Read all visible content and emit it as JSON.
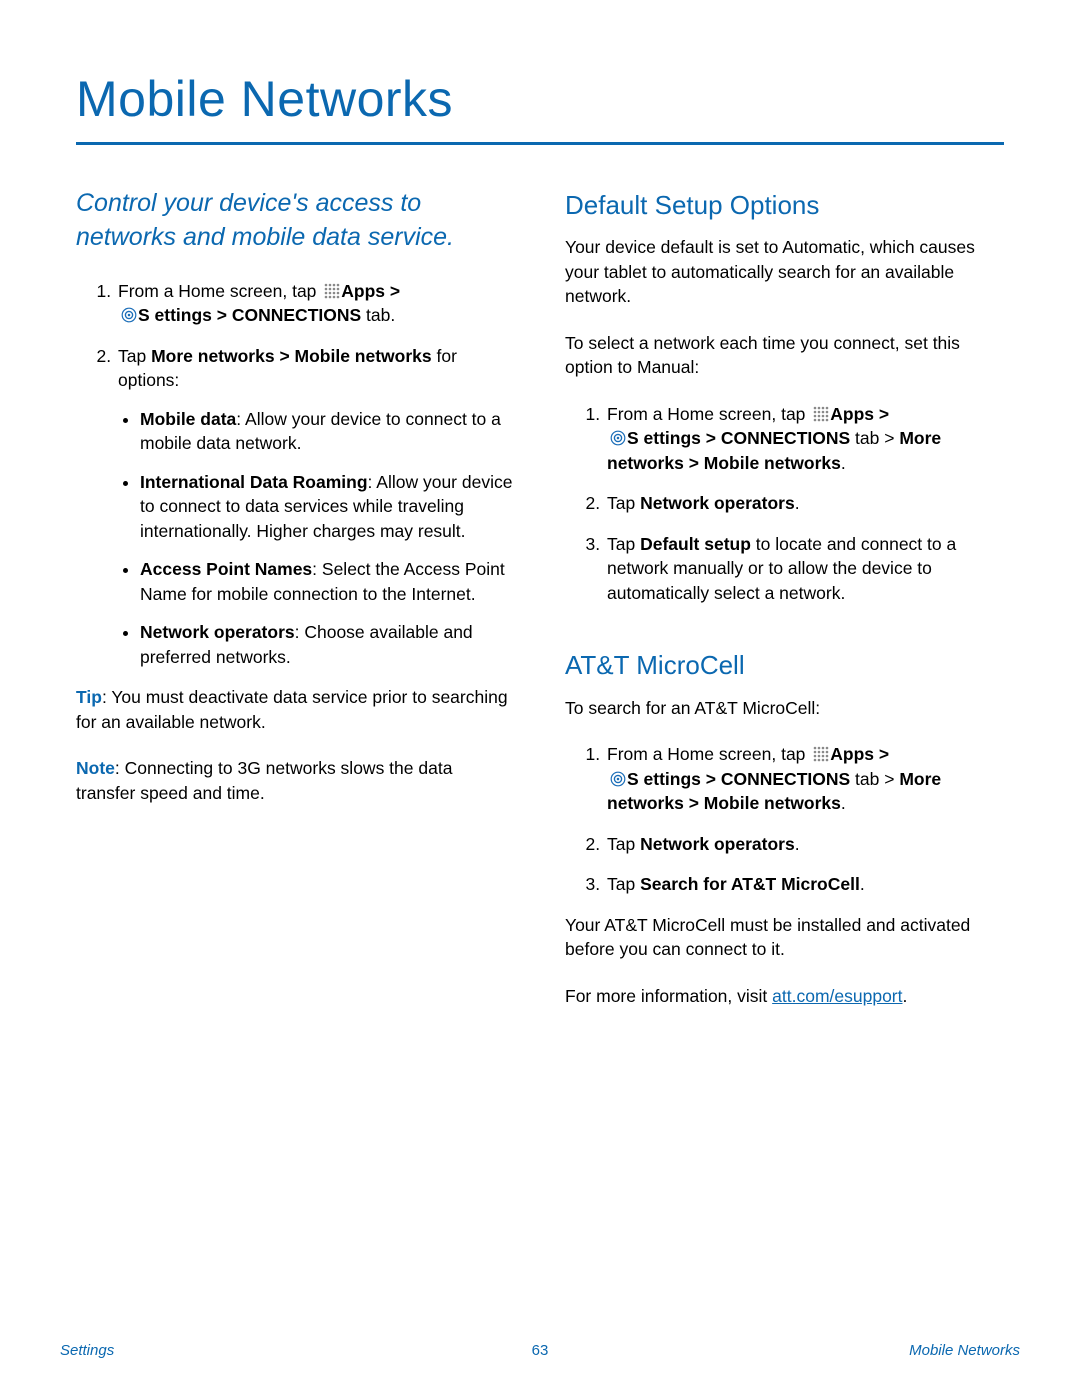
{
  "title": "Mobile Networks",
  "intro": "Control your device's access to networks and mobile data service.",
  "left": {
    "step1": {
      "pre": "From a Home screen, tap ",
      "apps": "Apps",
      "gt1": " > ",
      "settings": "S ettings",
      "gt2": " > ",
      "connections": "CONNECTIONS",
      "tail": " tab."
    },
    "step2": {
      "pre": "Tap ",
      "bold": "More networks > Mobile networks",
      "tail": " for options:"
    },
    "bullets": {
      "b1": {
        "label": "Mobile data",
        "text": ": Allow your device to connect to a mobile data network."
      },
      "b2": {
        "label": "International Data Roaming",
        "text": ": Allow your device to connect to data services while traveling internationally. Higher charges may result."
      },
      "b3": {
        "label": "Access Point Names",
        "text": ": Select the Access Point Name for mobile connection to the Internet."
      },
      "b4": {
        "label": "Network operators",
        "text": ": Choose available and preferred networks."
      }
    },
    "tip": {
      "label": "Tip",
      "text": ": You must deactivate data service prior to searching for an available network."
    },
    "note": {
      "label": "Note",
      "text": ": Connecting to 3G networks slows the data transfer speed and time."
    }
  },
  "right": {
    "sec1": {
      "heading": "Default Setup Options",
      "p1": "Your device default is set to Automatic, which causes your tablet to automatically search for an available network.",
      "p2": "To select a network each time you connect, set this option to Manual:",
      "step1": {
        "pre": "From a Home screen, tap ",
        "apps": "Apps",
        "gt1": " > ",
        "settings": "S ettings",
        "gt2": " > ",
        "connections": "CONNECTIONS",
        "mid": " tab > ",
        "more": "More networks > Mobile networks",
        "tail": "."
      },
      "step2": {
        "pre": "Tap ",
        "bold": "Network operators",
        "tail": "."
      },
      "step3": {
        "pre": "Tap ",
        "bold": "Default setup",
        "tail": " to locate and connect to a network manually or to allow the device to automatically select a network."
      }
    },
    "sec2": {
      "heading": "AT&T MicroCell",
      "p1": "To search for an AT&T MicroCell:",
      "step1": {
        "pre": "From a Home screen, tap ",
        "apps": "Apps",
        "gt1": " > ",
        "settings": "S ettings",
        "gt2": " > ",
        "connections": "CONNECTIONS",
        "mid": " tab > ",
        "more": "More networks > Mobile networks",
        "tail": "."
      },
      "step2": {
        "pre": "Tap ",
        "bold": "Network operators",
        "tail": "."
      },
      "step3": {
        "pre": "Tap ",
        "bold": "Search for AT&T MicroCell",
        "tail": "."
      },
      "p2": "Your AT&T MicroCell must be installed and activated before you can connect to it.",
      "p3_pre": "For more information, visit ",
      "p3_link": "att.com/esupport",
      "p3_tail": "."
    }
  },
  "footer": {
    "left": "Settings",
    "center": "63",
    "right": "Mobile Networks"
  }
}
